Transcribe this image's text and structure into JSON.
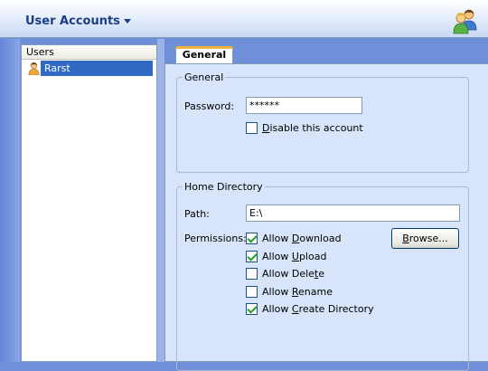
{
  "header": {
    "title": "User Accounts",
    "menu_icon": "chevron-down-icon",
    "app_icon": "users-icon"
  },
  "users": {
    "column_header": "Users",
    "items": [
      {
        "name": "Rarst",
        "icon": "user-icon",
        "selected": true
      }
    ]
  },
  "tabs": [
    {
      "label": "General",
      "active": true
    }
  ],
  "general_group": {
    "legend": "General",
    "password_label": "Password:",
    "password_value": "******",
    "disable_account": {
      "label_pre": "",
      "label_mnemonic": "D",
      "label_post": "isable this account",
      "checked": false
    }
  },
  "home_group": {
    "legend": "Home Directory",
    "path_label": "Path:",
    "path_value": "E:\\",
    "permissions_label": "Permissions:",
    "browse_button": {
      "label_pre": "",
      "label_mnemonic": "B",
      "label_post": "rowse..."
    },
    "permissions": [
      {
        "label_pre": "Allow ",
        "label_mnemonic": "D",
        "label_post": "ownload",
        "checked": true
      },
      {
        "label_pre": "Allow ",
        "label_mnemonic": "U",
        "label_post": "pload",
        "checked": true
      },
      {
        "label_pre": "Allow Dele",
        "label_mnemonic": "t",
        "label_post": "e",
        "checked": false
      },
      {
        "label_pre": "Allow ",
        "label_mnemonic": "R",
        "label_post": "ename",
        "checked": false
      },
      {
        "label_pre": "Allow ",
        "label_mnemonic": "C",
        "label_post": "reate Directory",
        "checked": true
      }
    ]
  },
  "colors": {
    "selection": "#316ac5",
    "title": "#1c3e87",
    "panel_bg": "#d7e4fa",
    "tab_accent": "#f0b336",
    "check_mark": "#21a121"
  }
}
